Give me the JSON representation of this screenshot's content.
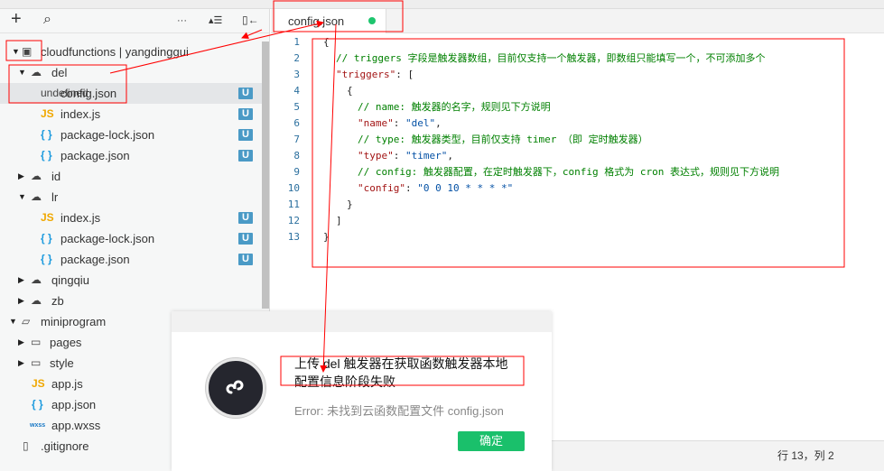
{
  "toolbar": {
    "add": "+",
    "search": "⌕",
    "more": "···",
    "collapse": "▴☰",
    "split": "▯←"
  },
  "tree": [
    {
      "label": "cloudfunctions | yangdinggui"
    },
    {
      "label": "del"
    },
    {
      "label": "config.json",
      "badge": "U"
    },
    {
      "label": "index.js",
      "badge": "U",
      "icon_text": "JS"
    },
    {
      "label": "package-lock.json",
      "badge": "U",
      "icon_text": "{ }"
    },
    {
      "label": "package.json",
      "badge": "U",
      "icon_text": "{ }"
    },
    {
      "label": "id"
    },
    {
      "label": "lr"
    },
    {
      "label": "index.js",
      "badge": "U",
      "icon_text": "JS"
    },
    {
      "label": "package-lock.json",
      "badge": "U",
      "icon_text": "{ }"
    },
    {
      "label": "package.json",
      "badge": "U",
      "icon_text": "{ }"
    },
    {
      "label": "qingqiu"
    },
    {
      "label": "zb"
    },
    {
      "label": "miniprogram"
    },
    {
      "label": "pages"
    },
    {
      "label": "style"
    },
    {
      "label": "app.js",
      "icon_text": "JS"
    },
    {
      "label": "app.json",
      "icon_text": "{ }"
    },
    {
      "label": "app.wxss",
      "icon_text": "wxss"
    },
    {
      "label": ".gitignore"
    }
  ],
  "editor": {
    "tab": "config.json",
    "lines": [
      [
        [
          "p",
          "{"
        ]
      ],
      [
        [
          "c",
          "// triggers 字段是触发器数组，目前仅支持一个触发器，即数组只能填写一个，不可添加多个"
        ]
      ],
      [
        [
          "k",
          "\"triggers\""
        ],
        [
          "p",
          ": ["
        ]
      ],
      [
        [
          "p",
          "{"
        ]
      ],
      [
        [
          "c",
          "// name: 触发器的名字，规则见下方说明"
        ]
      ],
      [
        [
          "k",
          "\"name\""
        ],
        [
          "p",
          ": "
        ],
        [
          "s",
          "\"del\""
        ],
        [
          "p",
          ","
        ]
      ],
      [
        [
          "c",
          "// type: 触发器类型，目前仅支持 timer （即 定时触发器）"
        ]
      ],
      [
        [
          "k",
          "\"type\""
        ],
        [
          "p",
          ": "
        ],
        [
          "s",
          "\"timer\""
        ],
        [
          "p",
          ","
        ]
      ],
      [
        [
          "c",
          "// config: 触发器配置，在定时触发器下，config 格式为 cron 表达式，规则见下方说明"
        ]
      ],
      [
        [
          "k",
          "\"config\""
        ],
        [
          "p",
          ": "
        ],
        [
          "s",
          "\"0 0 10 * * * *\""
        ]
      ],
      [
        [
          "p",
          "}"
        ]
      ],
      [
        [
          "p",
          "]"
        ]
      ],
      [
        [
          "p",
          "}"
        ]
      ]
    ]
  },
  "status": {
    "position": "行 13，列 2"
  },
  "dialog": {
    "title": "上传 del 触发器在获取函数触发器本地配置信息阶段失败",
    "error": "Error: 未找到云函数配置文件 config.json",
    "ok": "确定"
  },
  "colors": {
    "accent": "#1ac06b",
    "badge": "#4a9ac6",
    "annotation": "#ff0000"
  }
}
